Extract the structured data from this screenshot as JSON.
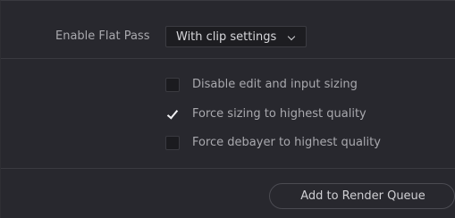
{
  "flat_pass": {
    "label": "Enable Flat Pass",
    "selected": "With clip settings"
  },
  "options": [
    {
      "label": "Disable edit and input sizing",
      "checked": false
    },
    {
      "label": "Force sizing to highest quality",
      "checked": true
    },
    {
      "label": "Force debayer to highest quality",
      "checked": false
    }
  ],
  "actions": {
    "add_to_queue_label": "Add to Render Queue"
  },
  "icons": {
    "dropdown": "chevron-down-icon",
    "check": "checkmark-icon"
  }
}
